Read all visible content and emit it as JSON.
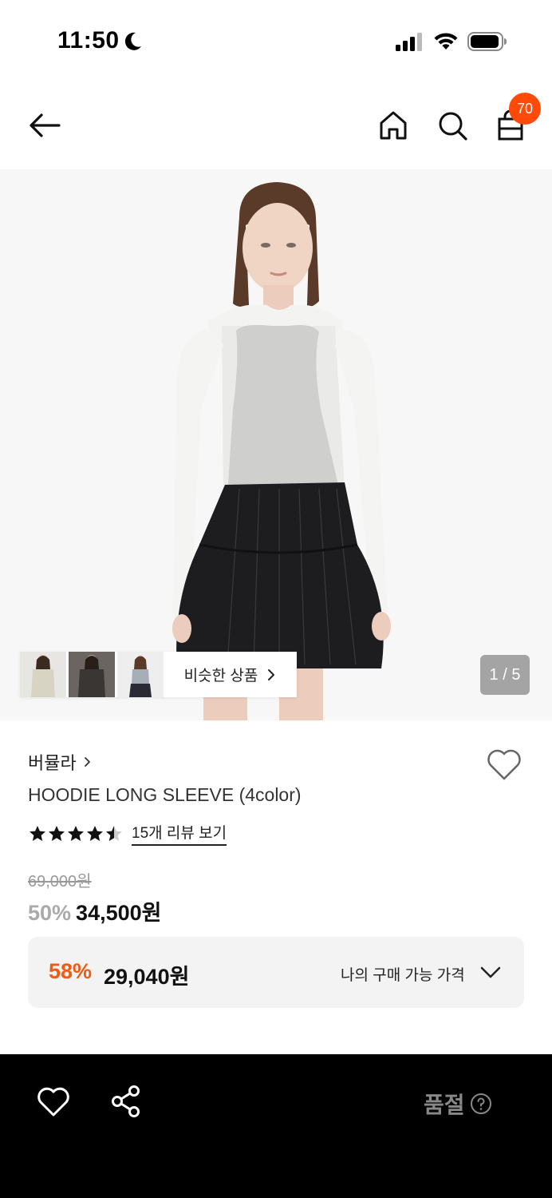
{
  "status_bar": {
    "time": "11:50"
  },
  "nav": {
    "cart_count": "70"
  },
  "gallery": {
    "similar_label": "비슷한 상품",
    "page_indicator": "1 / 5"
  },
  "product": {
    "brand": "버뮬라",
    "name": "HOODIE LONG SLEEVE (4color)",
    "rating": 4.5,
    "review_link": "15개 리뷰 보기",
    "original_price": "69,000원",
    "sale_rate": "50%",
    "sale_price": "34,500원"
  },
  "my_price": {
    "rate": "58%",
    "price": "29,040원",
    "label": "나의 구매 가능 가격"
  },
  "bottom_bar": {
    "soldout_label": "품절"
  },
  "colors": {
    "accent": "#f25a12",
    "badge": "#ff4a0a",
    "bottom_bar_bg": "#000000"
  }
}
